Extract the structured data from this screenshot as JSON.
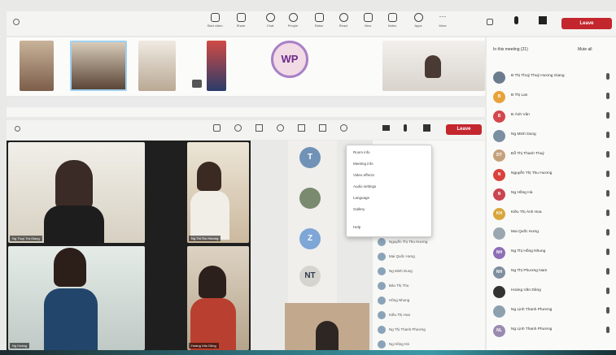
{
  "outer_toolbar": {
    "leave_label": "Leave",
    "buttons": [
      "Start video",
      "Share",
      "Chat",
      "People",
      "Raise",
      "React",
      "View",
      "Notes",
      "Apps",
      "More"
    ]
  },
  "filmstrip": {
    "wp_initials": "WP"
  },
  "participant_panel": {
    "header": "In this meeting (21)",
    "mute_all": "Mute all",
    "people": [
      {
        "initials": "",
        "name": "B Thị Thuý Thuỷ Hương Giang",
        "color": "#6b7c8e"
      },
      {
        "initials": "B",
        "name": "B Thị Lan",
        "color": "#e8a23a"
      },
      {
        "initials": "B",
        "name": "B Ánh Vân",
        "color": "#d4474a"
      },
      {
        "initials": "",
        "name": "Ng Minh Dung",
        "color": "#7a8fa1"
      },
      {
        "initials": "DT",
        "name": "Đỗ Thị Thanh Thuỷ",
        "color": "#c6a07a"
      },
      {
        "initials": "N",
        "name": "Nguyễn Thị Thu Hương",
        "color": "#d9423b"
      },
      {
        "initials": "N",
        "name": "Ng Hồng Hà",
        "color": "#c9444e"
      },
      {
        "initials": "KH",
        "name": "Kiều Thị Ánh Hoa",
        "color": "#d9a63b"
      },
      {
        "initials": "",
        "name": "Mai Quốc Hưng",
        "color": "#9aa7b0"
      },
      {
        "initials": "NH",
        "name": "Ng Thị Hồng Nhung",
        "color": "#8c6fb5"
      },
      {
        "initials": "NH",
        "name": "Ng Thị Phương Nam",
        "color": "#7f8fa0"
      },
      {
        "initials": "",
        "name": "Hoàng Văn Dũng",
        "color": "#333333"
      },
      {
        "initials": "",
        "name": "Ng Lịnh Thanh Phương",
        "color": "#8da0ad"
      },
      {
        "initials": "NL",
        "name": "Ng Lịnh Thanh Phương",
        "color": "#9b8ab0"
      }
    ]
  },
  "inner_window": {
    "leave_label": "Leave",
    "menu_items": [
      "Room info",
      "Meeting info",
      "Video effects",
      "Audio settings",
      "Language",
      "Gallery",
      "Help"
    ],
    "circle_labels": [
      "T",
      "Z",
      "NT"
    ],
    "list_items": [
      "Nguyễn Thị Thu Hương",
      "Mai Quốc Hưng",
      "Ng Minh Dung",
      "Bảo Thị Thu",
      "Hồng Nhung",
      "Kiều Thị Hoa",
      "Ng Thị Thanh Phương",
      "Ng Hồng Hà"
    ]
  },
  "tiles": [
    {
      "name": "Ng Thuý Trà Giang",
      "bg": "#3b3f3c"
    },
    {
      "name": "Ng Thị Thu Hương",
      "bg": "#d9cfc0"
    },
    {
      "name": "Ng Hoàng",
      "bg": "#2a4d6b"
    },
    {
      "name": "Hoàng Văn Dũng",
      "bg": "#b9ab95"
    }
  ]
}
